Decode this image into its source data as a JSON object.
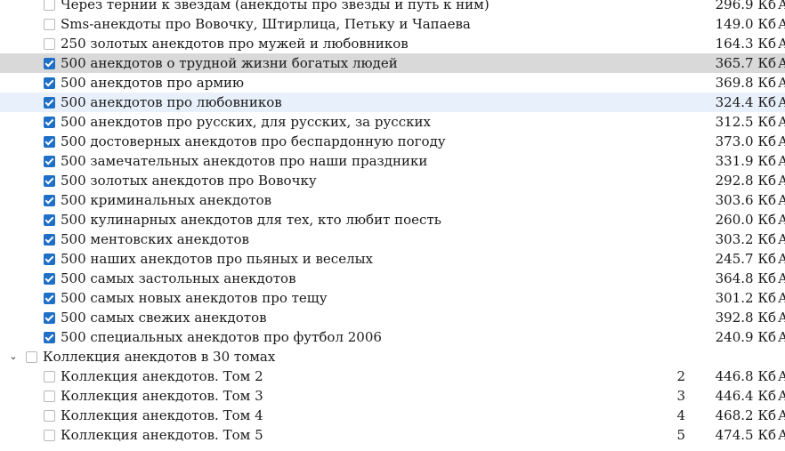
{
  "colors": {
    "accent": "#1f6fc7",
    "selected_row": "#d9d9d9",
    "hover_row": "#e8f1fb"
  },
  "rows": [
    {
      "level": 1,
      "name": "Через тернии к звездам (анекдоты про звезды и путь к ним)",
      "num": "",
      "size": "296.9 Кб",
      "extra": "А",
      "checked": false,
      "state": ""
    },
    {
      "level": 1,
      "name": "Sms-анекдоты про Вовочку, Штирлица, Петьку и Чапаева",
      "num": "",
      "size": "149.0 Кб",
      "extra": "А",
      "checked": false,
      "state": ""
    },
    {
      "level": 1,
      "name": "250 золотых анекдотов про мужей и любовников",
      "num": "",
      "size": "164.3 Кб",
      "extra": "А",
      "checked": false,
      "state": ""
    },
    {
      "level": 1,
      "name": "500 анекдотов о трудной жизни богатых людей",
      "num": "",
      "size": "365.7 Кб",
      "extra": "А",
      "checked": true,
      "state": "selected"
    },
    {
      "level": 1,
      "name": "500 анекдотов про армию",
      "num": "",
      "size": "369.8 Кб",
      "extra": "А",
      "checked": true,
      "state": ""
    },
    {
      "level": 1,
      "name": "500 анекдотов про любовников",
      "num": "",
      "size": "324.4 Кб",
      "extra": "А",
      "checked": true,
      "state": "hover"
    },
    {
      "level": 1,
      "name": "500 анекдотов про русских, для русских, за русских",
      "num": "",
      "size": "312.5 Кб",
      "extra": "А",
      "checked": true,
      "state": ""
    },
    {
      "level": 1,
      "name": "500 достоверных анекдотов про беспардонную погоду",
      "num": "",
      "size": "373.0 Кб",
      "extra": "А",
      "checked": true,
      "state": ""
    },
    {
      "level": 1,
      "name": "500 замечательных анекдотов про наши праздники",
      "num": "",
      "size": "331.9 Кб",
      "extra": "А",
      "checked": true,
      "state": ""
    },
    {
      "level": 1,
      "name": "500 золотых анекдотов про Вовочку",
      "num": "",
      "size": "292.8 Кб",
      "extra": "А",
      "checked": true,
      "state": ""
    },
    {
      "level": 1,
      "name": "500 криминальных анекдотов",
      "num": "",
      "size": "303.6 Кб",
      "extra": "А",
      "checked": true,
      "state": ""
    },
    {
      "level": 1,
      "name": "500 кулинарных анекдотов для тех, кто любит поесть",
      "num": "",
      "size": "260.0 Кб",
      "extra": "А",
      "checked": true,
      "state": ""
    },
    {
      "level": 1,
      "name": "500 ментовских анекдотов",
      "num": "",
      "size": "303.2 Кб",
      "extra": "А",
      "checked": true,
      "state": ""
    },
    {
      "level": 1,
      "name": "500 наших анекдотов про пьяных и веселых",
      "num": "",
      "size": "245.7 Кб",
      "extra": "А",
      "checked": true,
      "state": ""
    },
    {
      "level": 1,
      "name": "500 самых застольных анекдотов",
      "num": "",
      "size": "364.8 Кб",
      "extra": "А",
      "checked": true,
      "state": ""
    },
    {
      "level": 1,
      "name": "500 самых новых анекдотов про тещу",
      "num": "",
      "size": "301.2 Кб",
      "extra": "А",
      "checked": true,
      "state": ""
    },
    {
      "level": 1,
      "name": "500 самых свежих анекдотов",
      "num": "",
      "size": "392.8 Кб",
      "extra": "А",
      "checked": true,
      "state": ""
    },
    {
      "level": 1,
      "name": "500 специальных анекдотов про футбол 2006",
      "num": "",
      "size": "240.9 Кб",
      "extra": "А",
      "checked": true,
      "state": ""
    },
    {
      "level": 0,
      "name": "Коллекция анекдотов в 30 томах",
      "num": "",
      "size": "",
      "extra": "",
      "checked": false,
      "state": "",
      "expanded": true
    },
    {
      "level": 1,
      "name": "Коллекция анекдотов. Том 2",
      "num": "2",
      "size": "446.8 Кб",
      "extra": "А",
      "checked": false,
      "state": ""
    },
    {
      "level": 1,
      "name": "Коллекция анекдотов. Том 3",
      "num": "3",
      "size": "446.4 Кб",
      "extra": "А",
      "checked": false,
      "state": ""
    },
    {
      "level": 1,
      "name": "Коллекция анекдотов. Том 4",
      "num": "4",
      "size": "468.2 Кб",
      "extra": "А",
      "checked": false,
      "state": ""
    },
    {
      "level": 1,
      "name": "Коллекция анекдотов. Том 5",
      "num": "5",
      "size": "474.5 Кб",
      "extra": "А",
      "checked": false,
      "state": ""
    }
  ]
}
